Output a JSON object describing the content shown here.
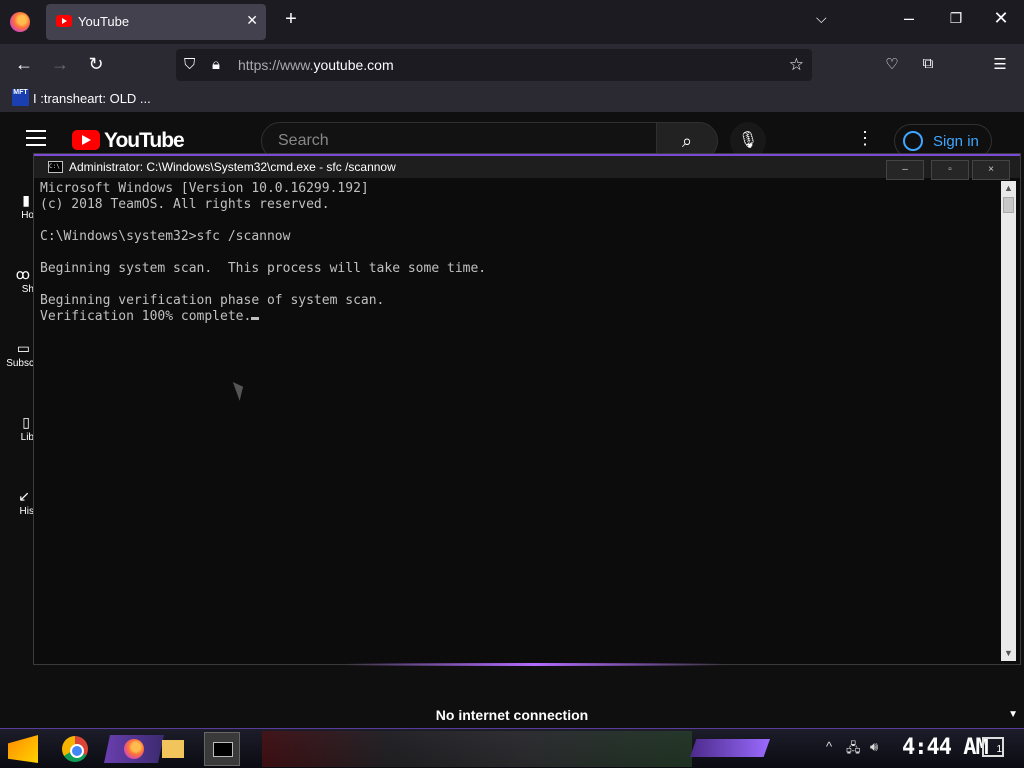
{
  "browser": {
    "tab": {
      "title": "YouTube"
    },
    "url": {
      "prefix": "https://www.",
      "domain": "youtube.com"
    },
    "bookmark": {
      "label": "I :transheart: OLD ...",
      "favicon_text": "MFT"
    }
  },
  "youtube": {
    "logo_text": "YouTube",
    "search_placeholder": "Search",
    "signin_label": "Sign in",
    "sidebar": [
      "Ho",
      "Sh",
      "Subsc",
      "Lib",
      "His"
    ]
  },
  "cmd": {
    "title": "Administrator: C:\\Windows\\System32\\cmd.exe - sfc  /scannow",
    "lines": [
      "Microsoft Windows [Version 10.0.16299.192]",
      "(c) 2018 TeamOS. All rights reserved.",
      "",
      "C:\\Windows\\system32>sfc /scannow",
      "",
      "Beginning system scan.  This process will take some time.",
      "",
      "Beginning verification phase of system scan.",
      "Verification 100% complete."
    ],
    "buttons": {
      "minimize": "–",
      "maximize": "▫",
      "close": "×"
    }
  },
  "status": {
    "offline_text": "No internet connection"
  },
  "taskbar": {
    "clock": "4:44 AM",
    "notification_count": "1"
  },
  "colors": {
    "accent": "#7b4bd6",
    "youtube_red": "#ff0000",
    "link_blue": "#3ea6ff"
  }
}
